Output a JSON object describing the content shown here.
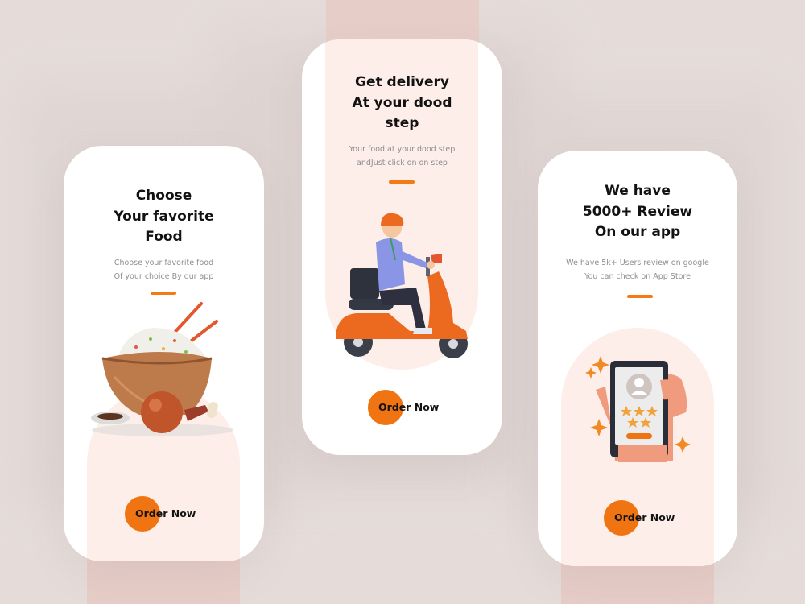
{
  "screens": [
    {
      "title_lines": [
        "Choose",
        "Your favorite",
        "Food"
      ],
      "subtitle_lines": [
        "Choose your favorite food",
        "Of your choice By our app"
      ],
      "illustration_icon": "food-bowl-icon",
      "button_label": "Order Now"
    },
    {
      "title_lines": [
        "Get delivery",
        "At your dood",
        "step"
      ],
      "subtitle_lines": [
        "Your food at your dood step",
        "andJust click on on step"
      ],
      "illustration_icon": "scooter-delivery-icon",
      "button_label": "Order Now"
    },
    {
      "title_lines": [
        "We have",
        "5000+ Review",
        "On our app"
      ],
      "subtitle_lines": [
        "We have 5k+ Users review on google",
        "You can check on App Store"
      ],
      "illustration_icon": "phone-review-icon",
      "button_label": "Order Now"
    }
  ],
  "colors": {
    "background": "#e5dcda",
    "card": "#ffffff",
    "arch": "#fdeee9",
    "accent": "#f07412"
  }
}
